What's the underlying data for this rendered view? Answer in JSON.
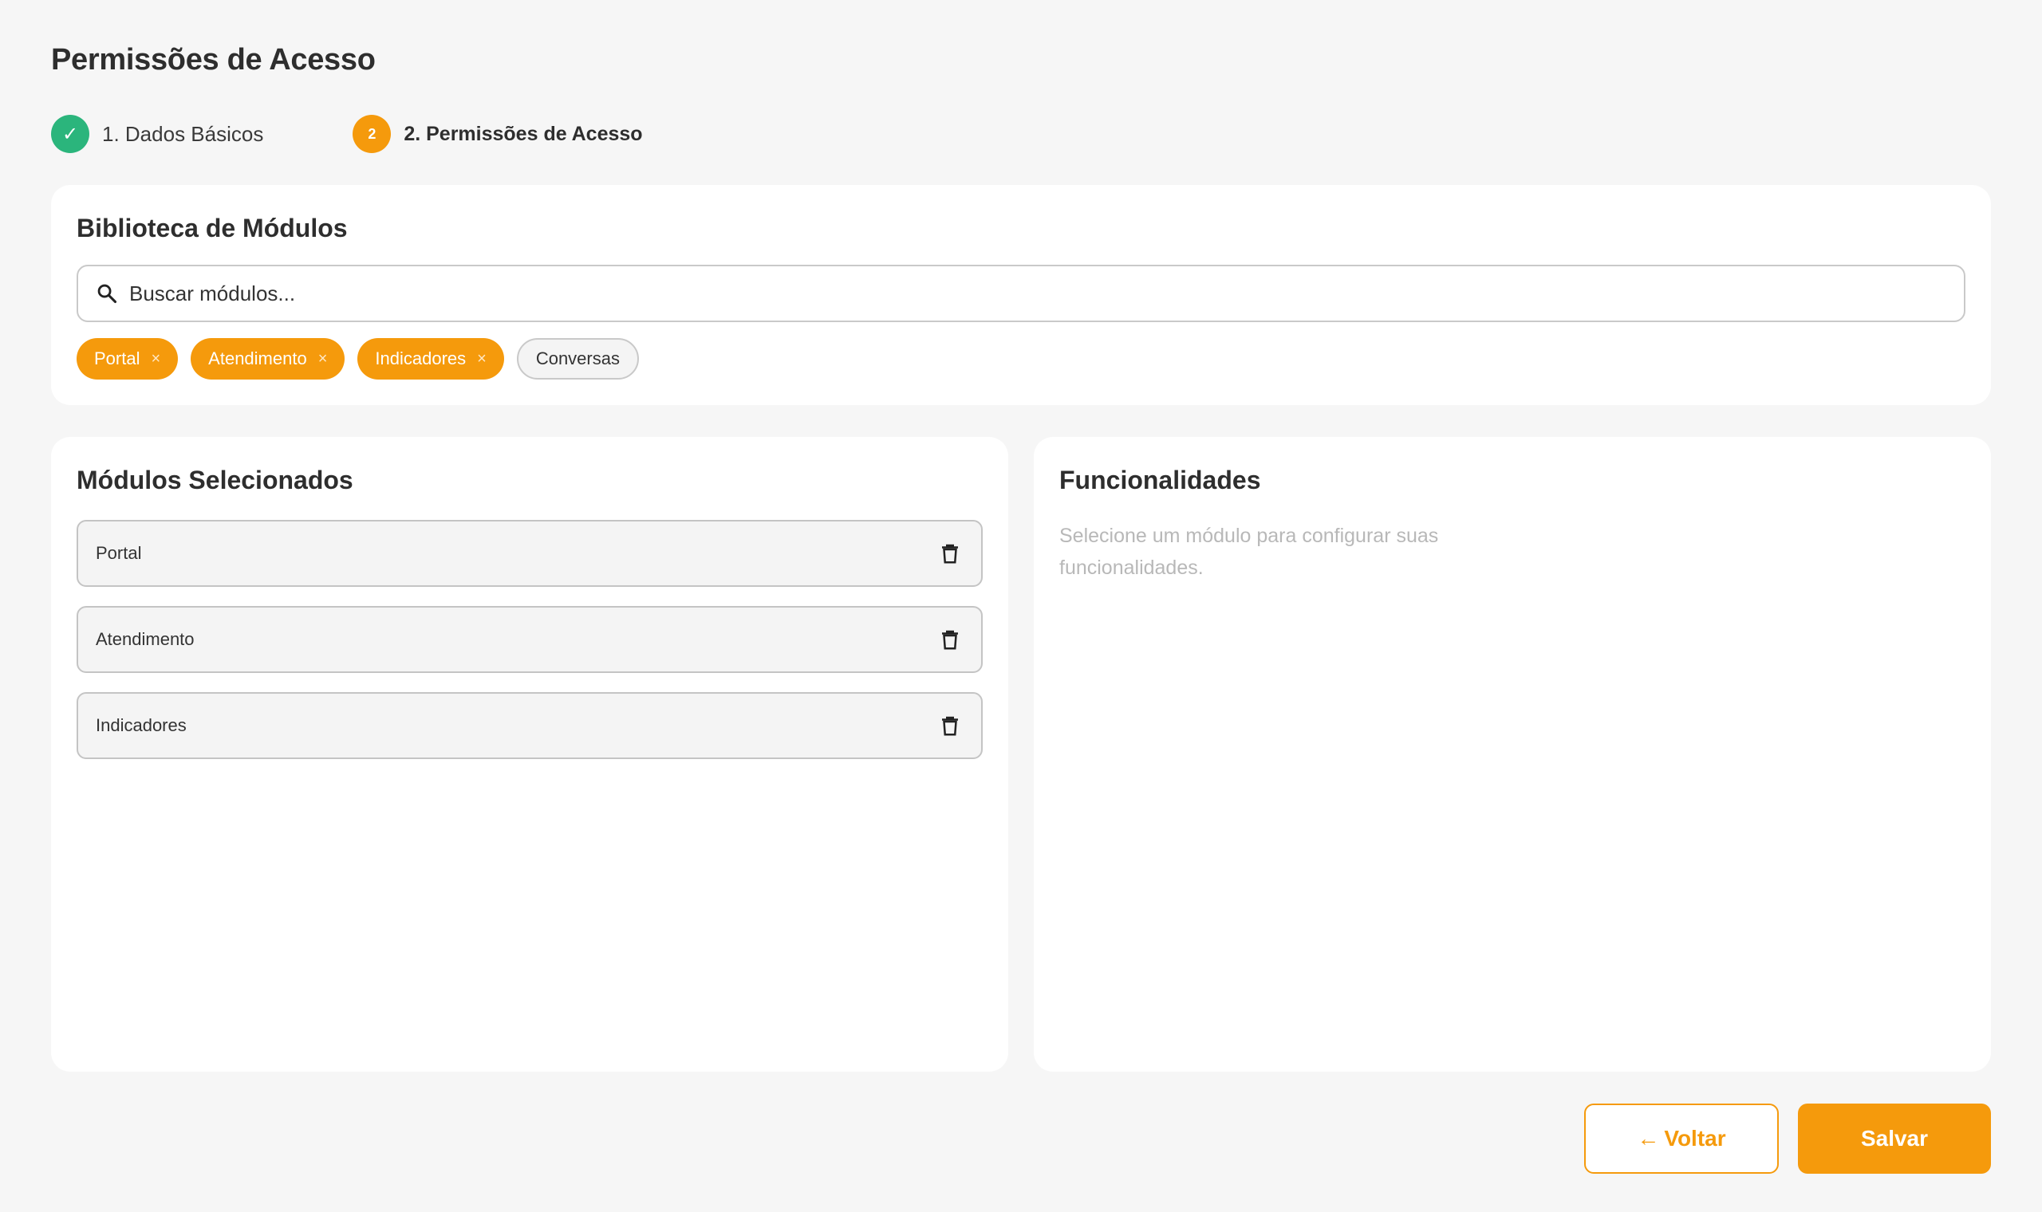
{
  "page": {
    "title": "Permissões de Acesso"
  },
  "stepper": {
    "steps": [
      {
        "label": "1. Dados Básicos",
        "state": "done",
        "marker": "✓"
      },
      {
        "label": "2. Permissões de Acesso",
        "state": "active",
        "marker": "2"
      }
    ]
  },
  "library": {
    "title": "Biblioteca de Módulos",
    "search_placeholder": "Buscar módulos...",
    "search_value": "",
    "chips": [
      {
        "label": "Portal",
        "selected": true,
        "remove": "×"
      },
      {
        "label": "Atendimento",
        "selected": true,
        "remove": "×"
      },
      {
        "label": "Indicadores",
        "selected": true,
        "remove": "×"
      },
      {
        "label": "Conversas",
        "selected": false
      }
    ]
  },
  "selected_modules": {
    "title": "Módulos Selecionados",
    "items": [
      {
        "name": "Portal"
      },
      {
        "name": "Atendimento"
      },
      {
        "name": "Indicadores"
      }
    ]
  },
  "features": {
    "title": "Funcionalidades",
    "hint": "Selecione um módulo para configurar suas funcionalidades."
  },
  "actions": {
    "back_arrow": "←",
    "back_label": "Voltar",
    "save_label": "Salvar"
  },
  "colors": {
    "accent": "#f59a0c",
    "success": "#2bb57c",
    "background": "#f6f6f6"
  },
  "icons": {
    "search": "search-icon",
    "trash": "trash-icon",
    "check": "check-icon"
  }
}
